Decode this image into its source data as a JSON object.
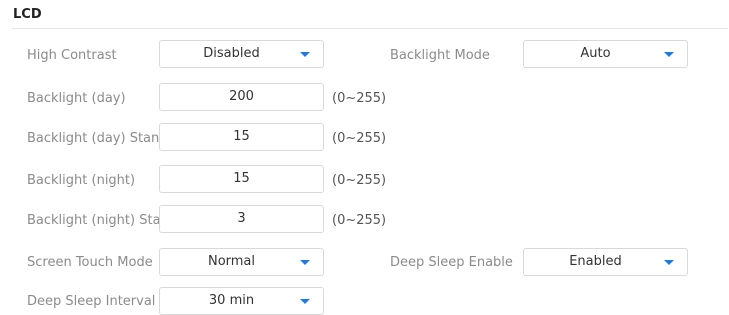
{
  "section": {
    "title": "LCD"
  },
  "high_contrast": {
    "label": "High Contrast",
    "value": "Disabled"
  },
  "backlight_mode": {
    "label": "Backlight Mode",
    "value": "Auto"
  },
  "backlight_day": {
    "label": "Backlight (day)",
    "value": "200",
    "range": "(0~255)"
  },
  "backlight_day_standby": {
    "label": "Backlight (day) Stan...",
    "value": "15",
    "range": "(0~255)"
  },
  "backlight_night": {
    "label": "Backlight (night)",
    "value": "15",
    "range": "(0~255)"
  },
  "backlight_night_standby": {
    "label": "Backlight (night) Sta...",
    "value": "3",
    "range": "(0~255)"
  },
  "screen_touch_mode": {
    "label": "Screen Touch Mode",
    "value": "Normal"
  },
  "deep_sleep_enable": {
    "label": "Deep Sleep Enable",
    "value": "Enabled"
  },
  "deep_sleep_interval": {
    "label": "Deep Sleep Interval",
    "value": "30 min"
  },
  "colors": {
    "accent": "#1f7ae0",
    "label": "#8b8b8b",
    "border": "#d9d9d9"
  },
  "icons": {
    "dropdown": "chevron-down-icon"
  }
}
